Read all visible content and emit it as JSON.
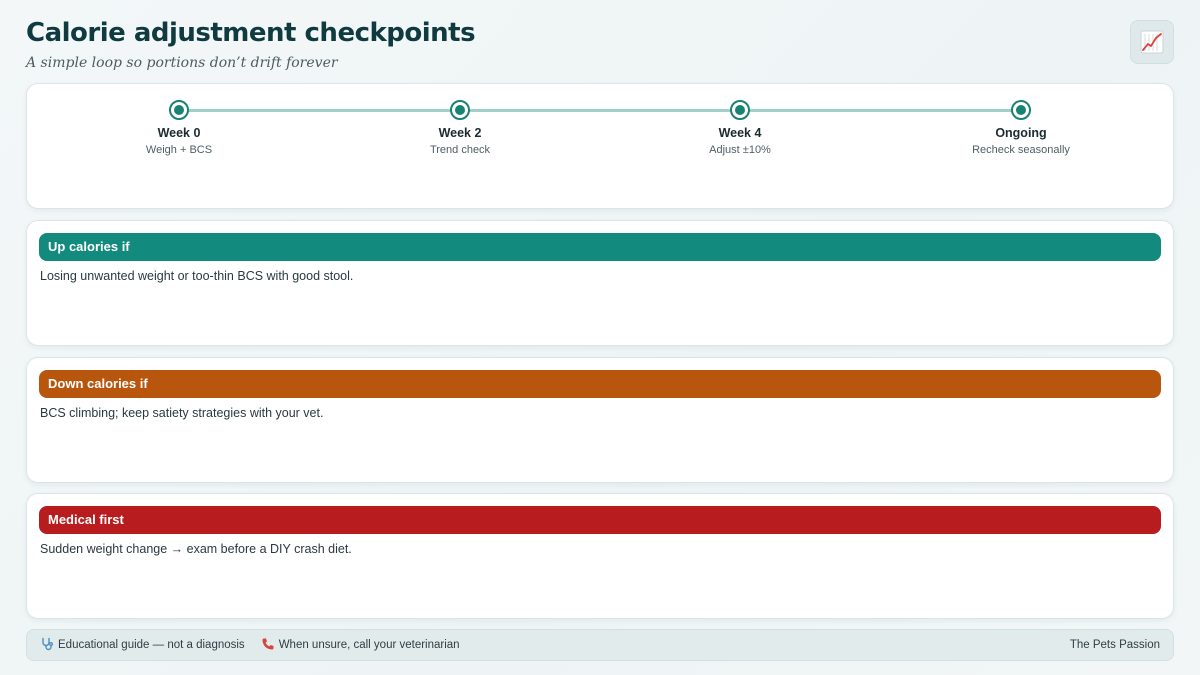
{
  "header": {
    "title": "Calorie adjustment checkpoints",
    "subtitle": "A simple loop so portions don’t drift forever",
    "icon": "chart-increasing-icon"
  },
  "timeline": {
    "steps": [
      {
        "label": "Week 0",
        "sub": "Weigh + BCS"
      },
      {
        "label": "Week 2",
        "sub": "Trend check"
      },
      {
        "label": "Week 4",
        "sub": "Adjust ±10%"
      },
      {
        "label": "Ongoing",
        "sub": "Recheck seasonally"
      }
    ],
    "colors": {
      "track": "#9fcfcb",
      "dot": "#1a8273"
    }
  },
  "rules": {
    "up": {
      "heading": "Up calories if",
      "text": "Losing unwanted weight or too-thin BCS with good stool.",
      "color": "#138a7e"
    },
    "down": {
      "heading": "Down calories if",
      "text": "BCS climbing; keep satiety strategies with your vet.",
      "color": "#b8560e"
    },
    "medical": {
      "heading": "Medical first",
      "text": "Sudden weight change → exam before a DIY crash diet.",
      "color": "#b81c1f"
    }
  },
  "footer": {
    "disclaimer": "Educational guide — not a diagnosis",
    "disclaimer_icon": "stethoscope-icon",
    "call": "When unsure, call your veterinarian",
    "call_icon": "phone-icon",
    "brand": "The Pets Passion"
  }
}
